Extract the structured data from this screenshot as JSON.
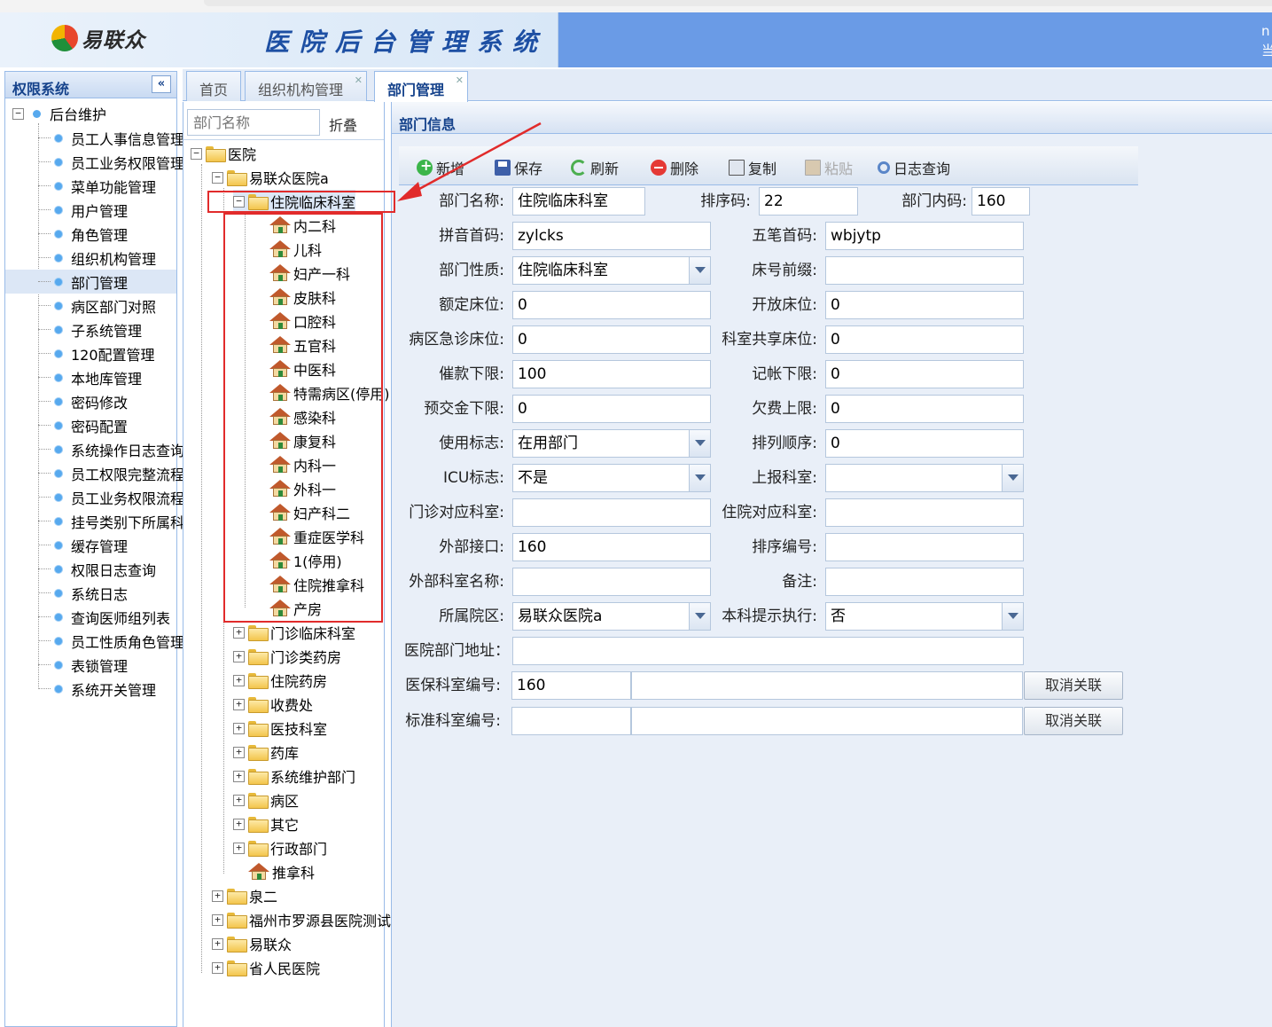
{
  "header": {
    "logo_text": "易联众",
    "system_title": "医院后台管理系统",
    "right_text": "n 当"
  },
  "left_nav": {
    "title": "权限系统",
    "collapse_icon": "«",
    "root": "后台维护",
    "items": [
      {
        "label": "员工人事信息管理"
      },
      {
        "label": "员工业务权限管理"
      },
      {
        "label": "菜单功能管理"
      },
      {
        "label": "用户管理"
      },
      {
        "label": "角色管理"
      },
      {
        "label": "组织机构管理"
      },
      {
        "label": "部门管理"
      },
      {
        "label": "病区部门对照"
      },
      {
        "label": "子系统管理"
      },
      {
        "label": "120配置管理"
      },
      {
        "label": "本地库管理"
      },
      {
        "label": "密码修改"
      },
      {
        "label": "密码配置"
      },
      {
        "label": "系统操作日志查询"
      },
      {
        "label": "员工权限完整流程"
      },
      {
        "label": "员工业务权限流程"
      },
      {
        "label": "挂号类别下所属科室"
      },
      {
        "label": "缓存管理"
      },
      {
        "label": "权限日志查询"
      },
      {
        "label": "系统日志"
      },
      {
        "label": "查询医师组列表"
      },
      {
        "label": "员工性质角色管理"
      },
      {
        "label": "表锁管理"
      },
      {
        "label": "系统开关管理"
      }
    ],
    "active_index": 6
  },
  "tabs": [
    {
      "label": "首页",
      "closable": false
    },
    {
      "label": "组织机构管理",
      "closable": true
    },
    {
      "label": "部门管理",
      "closable": true
    }
  ],
  "tree": {
    "search_placeholder": "部门名称",
    "fold_label": "折叠",
    "root": "医院",
    "hospital": "易联众医院a",
    "selected_group": "住院临床科室",
    "departments": [
      "内二科",
      "儿科",
      "妇产一科",
      "皮肤科",
      "口腔科",
      "五官科",
      "中医科",
      "特需病区(停用)",
      "感染科",
      "康复科",
      "内科一",
      "外科一",
      "妇产科二",
      "重症医学科",
      "1(停用)",
      "住院推拿科",
      "产房"
    ],
    "groups": [
      "门诊临床科室",
      "门诊类药房",
      "住院药房",
      "收费处",
      "医技科室",
      "药库",
      "系统维护部门",
      "病区",
      "其它",
      "行政部门"
    ],
    "leaf_dept": "推拿科",
    "top_level": [
      "泉二",
      "福州市罗源县医院测试",
      "易联众",
      "省人民医院"
    ]
  },
  "form": {
    "title": "部门信息",
    "toolbar": [
      {
        "label": "新增",
        "icon": "add-icon",
        "enabled": true
      },
      {
        "label": "保存",
        "icon": "save-icon",
        "enabled": true
      },
      {
        "label": "刷新",
        "icon": "refresh-icon",
        "enabled": true
      },
      {
        "label": "删除",
        "icon": "delete-icon",
        "enabled": true
      },
      {
        "label": "复制",
        "icon": "copy-icon",
        "enabled": true
      },
      {
        "label": "粘贴",
        "icon": "paste-icon",
        "enabled": false
      },
      {
        "label": "日志查询",
        "icon": "log-search-icon",
        "enabled": true
      }
    ],
    "fields": {
      "dept_name": {
        "label": "部门名称:",
        "value": "住院临床科室"
      },
      "sort_code": {
        "label": "排序码:",
        "value": "22"
      },
      "inner_code": {
        "label": "部门内码:",
        "value": "160"
      },
      "pinyin": {
        "label": "拼音首码:",
        "value": "zylcks"
      },
      "wubi": {
        "label": "五笔首码:",
        "value": "wbjytp"
      },
      "dept_type": {
        "label": "部门性质:",
        "value": "住院临床科室"
      },
      "bed_prefix": {
        "label": "床号前缀:",
        "value": ""
      },
      "rated_beds": {
        "label": "额定床位:",
        "value": "0"
      },
      "open_beds": {
        "label": "开放床位:",
        "value": "0"
      },
      "emergency_beds": {
        "label": "病区急诊床位:",
        "value": "0"
      },
      "shared_beds": {
        "label": "科室共享床位:",
        "value": "0"
      },
      "dunning_limit": {
        "label": "催款下限:",
        "value": "100"
      },
      "credit_limit": {
        "label": "记帐下限:",
        "value": "0"
      },
      "deposit_limit": {
        "label": "预交金下限:",
        "value": "0"
      },
      "arrears_limit": {
        "label": "欠费上限:",
        "value": "0"
      },
      "usage_flag": {
        "label": "使用标志:",
        "value": "在用部门"
      },
      "order": {
        "label": "排列顺序:",
        "value": "0"
      },
      "icu_flag": {
        "label": "ICU标志:",
        "value": "不是"
      },
      "report_dept": {
        "label": "上报科室:",
        "value": ""
      },
      "outpatient_dept": {
        "label": "门诊对应科室:",
        "value": ""
      },
      "inpatient_dept": {
        "label": "住院对应科室:",
        "value": ""
      },
      "ext_interface": {
        "label": "外部接口:",
        "value": "160"
      },
      "sort_number": {
        "label": "排序编号:",
        "value": ""
      },
      "ext_dept_name": {
        "label": "外部科室名称:",
        "value": ""
      },
      "remark": {
        "label": "备注:",
        "value": ""
      },
      "campus": {
        "label": "所属院区:",
        "value": "易联众医院a"
      },
      "prompt_exec": {
        "label": "本科提示执行:",
        "value": "否"
      },
      "address": {
        "label": "医院部门地址：",
        "value": ""
      },
      "insurance_code": {
        "label": "医保科室编号:",
        "value": "160",
        "extra": ""
      },
      "standard_code": {
        "label": "标准科室编号:",
        "value": "",
        "extra": ""
      }
    },
    "cancel_label": "取消关联"
  }
}
